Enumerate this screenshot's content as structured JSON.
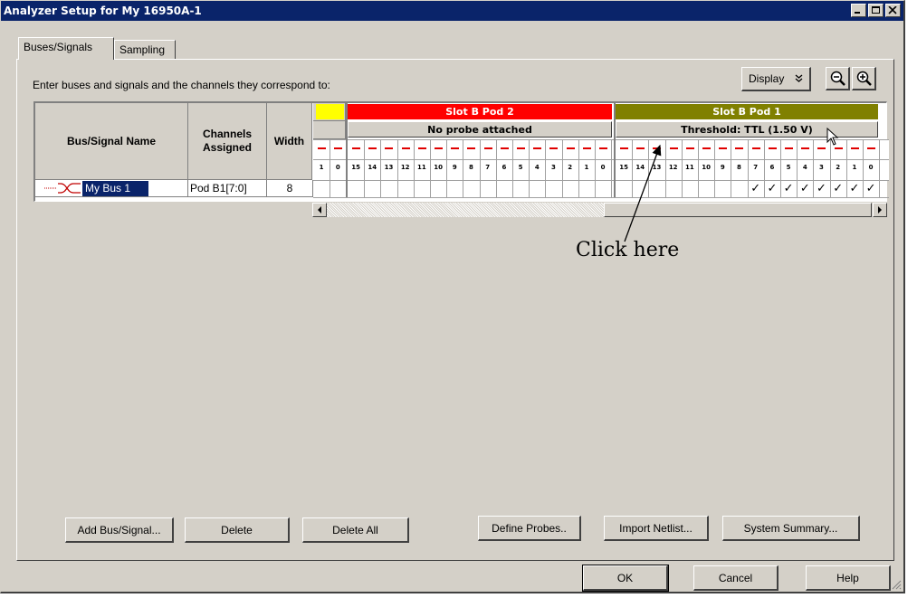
{
  "window": {
    "title": "Analyzer Setup for My 16950A-1",
    "title_buttons": [
      "minimize-icon",
      "maximize-icon",
      "close-icon"
    ]
  },
  "tabs": [
    {
      "label": "Buses/Signals",
      "active": true
    },
    {
      "label": "Sampling",
      "active": false
    }
  ],
  "instructions": "Enter buses and signals and the channels they correspond to:",
  "toolbar": {
    "display_label": "Display",
    "display_icon": "double-chevron-down-icon",
    "zoom_out_icon": "zoom-out-icon",
    "zoom_in_icon": "zoom-in-icon"
  },
  "grid": {
    "headers": {
      "name": "Bus/Signal Name",
      "channels": "Channels Assigned",
      "width": "Width"
    },
    "pods": [
      {
        "title": "",
        "color": "#ffff00",
        "status": "",
        "channels": [
          "1",
          "0"
        ]
      },
      {
        "title": "Slot B Pod 2",
        "color": "#ff0000",
        "status": "No probe attached",
        "channels": [
          "15",
          "14",
          "13",
          "12",
          "11",
          "10",
          "9",
          "8",
          "7",
          "6",
          "5",
          "4",
          "3",
          "2",
          "1",
          "0"
        ]
      },
      {
        "title": "Slot B Pod 1",
        "color": "#808000",
        "status": "Threshold: TTL (1.50 V)",
        "channels": [
          "15",
          "14",
          "13",
          "12",
          "11",
          "10",
          "9",
          "8",
          "7",
          "6",
          "5",
          "4",
          "3",
          "2",
          "1",
          "0"
        ]
      }
    ],
    "rows": [
      {
        "name": "My Bus 1",
        "channels": "Pod B1[7:0]",
        "width": "8",
        "icon": "bus-icon",
        "assigned_pod": "Slot B Pod 1",
        "assigned_channels": [
          "7",
          "6",
          "5",
          "4",
          "3",
          "2",
          "1",
          "0"
        ],
        "check_mark": "✓"
      }
    ]
  },
  "callout": {
    "text": "Click here"
  },
  "buttons": {
    "add": "Add Bus/Signal...",
    "delete": "Delete",
    "delete_all": "Delete All",
    "define_probes": "Define Probes..",
    "import_netlist": "Import Netlist...",
    "system_summary": "System Summary...",
    "ok": "OK",
    "cancel": "Cancel",
    "help": "Help"
  }
}
